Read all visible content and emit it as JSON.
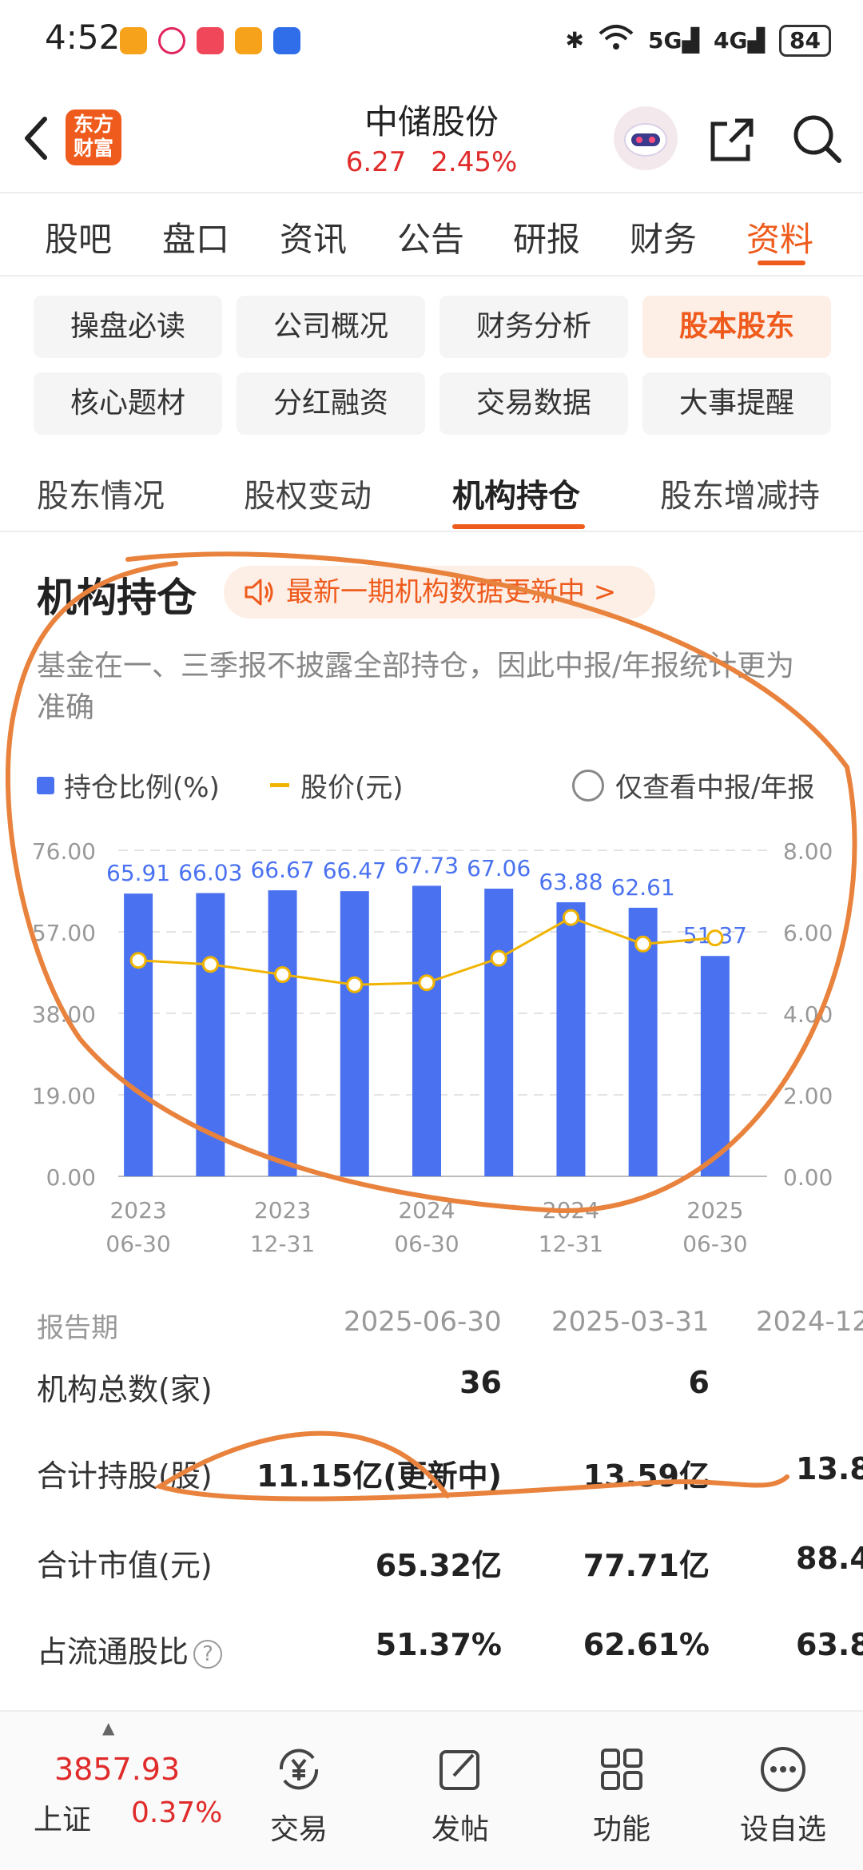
{
  "status_bar": {
    "time": "4:52",
    "network1": "5G",
    "network2": "4G",
    "battery": "84"
  },
  "header": {
    "stock_name": "中储股份",
    "price": "6.27",
    "change_pct": "2.45%",
    "logo_line1": "东方",
    "logo_line2": "财富"
  },
  "main_tabs": [
    "股吧",
    "盘口",
    "资讯",
    "公告",
    "研报",
    "财务",
    "资料"
  ],
  "active_main_tab": "资料",
  "grid_buttons": [
    "操盘必读",
    "公司概况",
    "财务分析",
    "股本股东",
    "核心题材",
    "分红融资",
    "交易数据",
    "大事提醒"
  ],
  "active_grid_button": "股本股东",
  "sub_tabs": [
    "股东情况",
    "股权变动",
    "机构持仓",
    "股东增减持"
  ],
  "active_sub_tab": "机构持仓",
  "section": {
    "title": "机构持仓",
    "notice": "最新一期机构数据更新中 >",
    "description": "基金在一、三季报不披露全部持仓，因此中报/年报统计更为准确"
  },
  "legend": {
    "bar": "持仓比例(%)",
    "line": "股价(元)",
    "toggle": "仅查看中报/年报"
  },
  "chart_data": {
    "type": "bar",
    "series": [
      {
        "name": "持仓比例(%)",
        "values": [
          65.91,
          66.03,
          66.67,
          66.47,
          67.73,
          67.06,
          63.88,
          62.61,
          51.37
        ],
        "color": "#4a72f0"
      },
      {
        "name": "股价(元)",
        "values": [
          5.3,
          5.2,
          4.95,
          4.7,
          4.75,
          5.35,
          6.35,
          5.7,
          5.85
        ],
        "color": "#f0b400",
        "axis": "right"
      }
    ],
    "data_labels": [
      "65.91",
      "66.03",
      "66.67",
      "66.47",
      "67.73",
      "67.06",
      "63.88",
      "62.61",
      "51.37"
    ],
    "left_ticks": [
      "76.00",
      "57.00",
      "38.00",
      "19.00",
      "0.00"
    ],
    "right_ticks": [
      "8.00",
      "6.00",
      "4.00",
      "2.00",
      "0.00"
    ],
    "x_labels": [
      [
        "2023",
        "06-30"
      ],
      [
        "2023",
        "12-31"
      ],
      [
        "2024",
        "06-30"
      ],
      [
        "2024",
        "12-31"
      ],
      [
        "2025",
        "06-30"
      ]
    ],
    "ylim_left": [
      0,
      76
    ],
    "ylim_right": [
      0,
      8
    ],
    "grid": true
  },
  "table": {
    "header_label": "报告期",
    "periods": [
      "2025-06-30",
      "2025-03-31",
      "2024-12"
    ],
    "rows": [
      {
        "label": "机构总数(家)",
        "values": [
          "36",
          "6",
          ""
        ]
      },
      {
        "label": "合计持股(股)",
        "values": [
          "11.15亿(更新中)",
          "13.59亿",
          "13.8"
        ]
      },
      {
        "label": "合计市值(元)",
        "values": [
          "65.32亿",
          "77.71亿",
          "88.4"
        ]
      },
      {
        "label": "占流通股比",
        "values": [
          "51.37%",
          "62.61%",
          "63.8"
        ]
      }
    ]
  },
  "bottom_bar": {
    "index_value": "3857.93",
    "index_name": "上证",
    "index_change": "0.37%",
    "nav": [
      "交易",
      "发帖",
      "功能",
      "设自选"
    ]
  },
  "colors": {
    "accent": "#ef5b1c",
    "up": "#e02b2b",
    "bar": "#4a72f0",
    "line": "#f0b400",
    "annotation": "#e8823c"
  }
}
